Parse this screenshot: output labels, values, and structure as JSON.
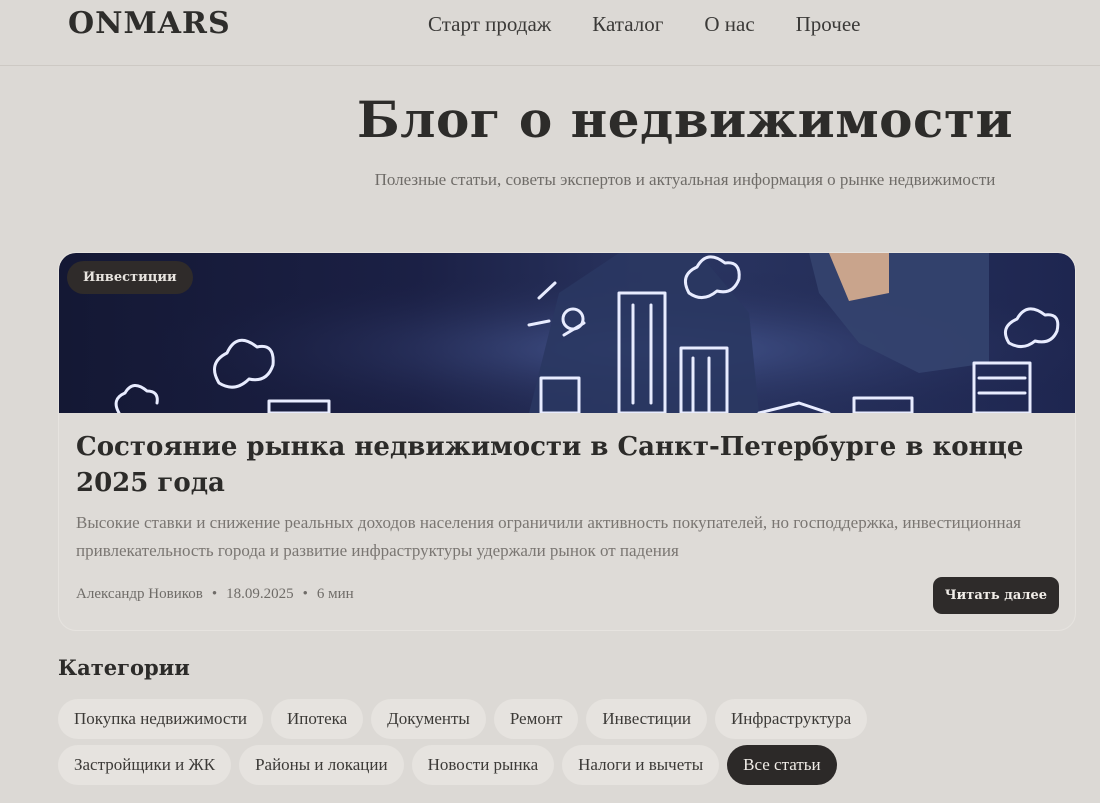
{
  "header": {
    "logo": "ONMARS",
    "nav": [
      "Старт продаж",
      "Каталог",
      "О нас",
      "Прочее"
    ]
  },
  "hero": {
    "title": "Блог о недвижимости",
    "subtitle": "Полезные статьи, советы экспертов и актуальная информация о рынке недвижимости"
  },
  "featured": {
    "badge": "Инвестиции",
    "title": "Состояние рынка недвижимости в Санкт-Петербурге в конце 2025 года",
    "description": "Высокие ставки и снижение реальных доходов населения ограничили активность покупателей, но господдержка, инвестиционная привлекательность города и развитие инфраструктуры удержали рынок от падения",
    "author": "Александр Новиков",
    "date": "18.09.2025",
    "read_time": "6 мин",
    "separator": "•",
    "read_more": "Читать далее"
  },
  "categories": {
    "title": "Категории",
    "row1": [
      "Покупка недвижимости",
      "Ипотека",
      "Документы",
      "Ремонт",
      "Инвестиции",
      "Инфраструктура"
    ],
    "row2": [
      "Застройщики и ЖК",
      "Районы и локации",
      "Новости рынка",
      "Налоги и вычеты",
      "Все статьи"
    ],
    "active": "Все статьи"
  },
  "colors": {
    "background": "#dcd9d5",
    "dark": "#2c2928",
    "chip": "#e6e3df",
    "image_navy": "#1b2045"
  }
}
